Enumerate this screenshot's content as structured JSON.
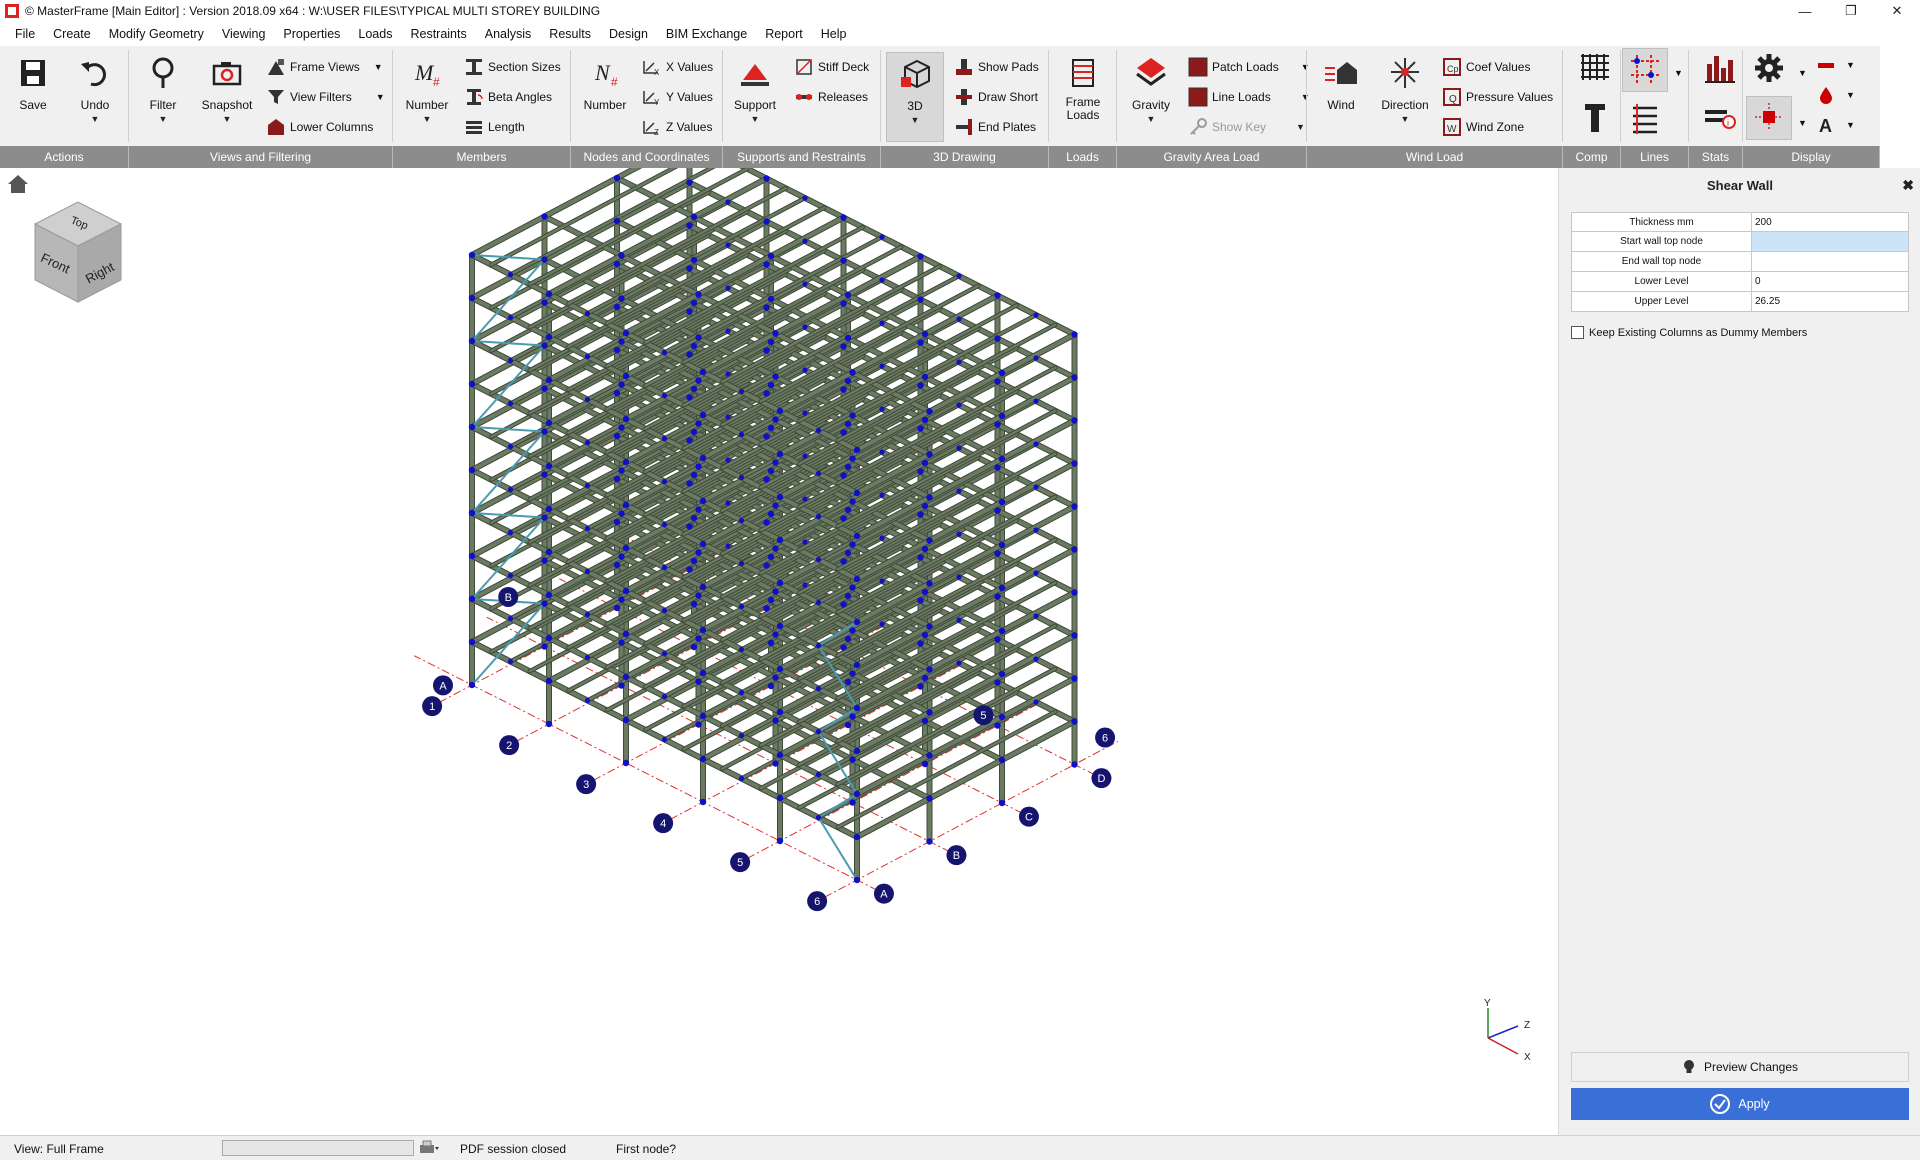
{
  "window": {
    "title": "© MasterFrame [Main Editor] : Version 2018.09 x64 : W:\\USER FILES\\TYPICAL MULTI STOREY BUILDING",
    "controls": [
      "—",
      "❐",
      "✕"
    ]
  },
  "menu": [
    "File",
    "Create",
    "Modify Geometry",
    "Viewing",
    "Properties",
    "Loads",
    "Restraints",
    "Analysis",
    "Results",
    "Design",
    "BIM Exchange",
    "Report",
    "Help"
  ],
  "ribbon": {
    "groups": [
      "Actions",
      "Views and Filtering",
      "Members",
      "Nodes and Coordinates",
      "Supports and Restraints",
      "3D Drawing",
      "Loads",
      "Gravity Area Load",
      "Wind Load",
      "Comp",
      "Lines",
      "Stats",
      "Display"
    ],
    "save": "Save",
    "undo": "Undo",
    "filter": "Filter",
    "snapshot": "Snapshot",
    "frame_views": "Frame Views",
    "view_filters": "View Filters",
    "lower_columns": "Lower Columns",
    "member_number": "Number",
    "section_sizes": "Section Sizes",
    "beta_angles": "Beta Angles",
    "length": "Length",
    "node_number": "Number",
    "x_values": "X Values",
    "y_values": "Y Values",
    "z_values": "Z Values",
    "support": "Support",
    "stiff_deck": "Stiff Deck",
    "releases": "Releases",
    "view_3d": "3D",
    "show_pads": "Show Pads",
    "draw_short": "Draw Short",
    "end_plates": "End Plates",
    "frame_loads": "Frame Loads",
    "gravity": "Gravity",
    "patch_loads": "Patch Loads",
    "line_loads": "Line Loads",
    "show_key": "Show Key",
    "wind": "Wind",
    "direction": "Direction",
    "coef_values": "Coef Values",
    "pressure_values": "Pressure Values",
    "wind_zone": "Wind Zone"
  },
  "panel": {
    "title": "Shear Wall",
    "close": "✖",
    "rows": [
      {
        "label": "Thickness mm",
        "value": "200"
      },
      {
        "label": "Start wall top node",
        "value": ""
      },
      {
        "label": "End wall top node",
        "value": ""
      },
      {
        "label": "Lower Level",
        "value": "0"
      },
      {
        "label": "Upper Level",
        "value": "26.25"
      }
    ],
    "checkbox_label": "Keep Existing Columns as Dummy Members",
    "checkbox_checked": false,
    "preview": "Preview Changes",
    "apply": "Apply"
  },
  "viewport": {
    "navcube_faces": [
      "Top",
      "Front",
      "Right"
    ],
    "axis_labels": [
      "Y",
      "Z",
      "X"
    ],
    "grid_labels_near": [
      "A",
      "1",
      "2",
      "3",
      "4",
      "5",
      "6"
    ],
    "grid_labels_far": [
      "A",
      "B",
      "C",
      "D",
      "6"
    ],
    "grid_labels_misc": [
      "B",
      "5"
    ]
  },
  "status": {
    "view": "View: Full Frame",
    "pdf": "PDF session closed",
    "prompt": "First node?"
  },
  "colors": {
    "member": "#6b7a62",
    "node": "#1010c8",
    "brace": "#4a9ab0",
    "grid_line": "#e03030",
    "grid_bubble": "#151570",
    "ribbon_group_bar": "#8c8c8c",
    "apply": "#3b6fd8"
  }
}
